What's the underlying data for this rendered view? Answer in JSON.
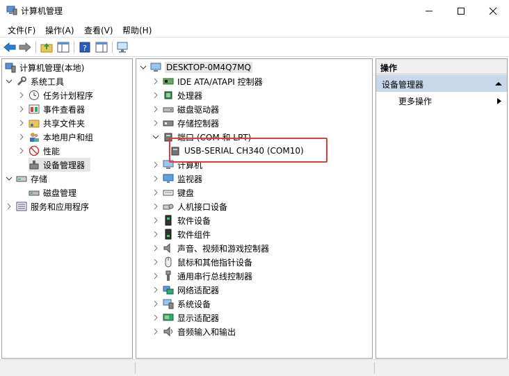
{
  "window": {
    "title": "计算机管理"
  },
  "menu": {
    "file": "文件(F)",
    "action": "操作(A)",
    "view": "查看(V)",
    "help": "帮助(H)"
  },
  "left_tree": {
    "root": "计算机管理(本地)",
    "system_tools": "系统工具",
    "task_scheduler": "任务计划程序",
    "event_viewer": "事件查看器",
    "shared_folders": "共享文件夹",
    "local_users": "本地用户和组",
    "performance": "性能",
    "device_manager": "设备管理器",
    "storage": "存储",
    "disk_management": "磁盘管理",
    "services": "服务和应用程序"
  },
  "device_tree": {
    "root": "DESKTOP-0M4Q7MQ",
    "categories": [
      {
        "label": "IDE ATA/ATAPI 控制器",
        "icon": "ide-controller-icon"
      },
      {
        "label": "处理器",
        "icon": "processor-icon"
      },
      {
        "label": "磁盘驱动器",
        "icon": "disk-drive-icon"
      },
      {
        "label": "存储控制器",
        "icon": "storage-controller-icon"
      },
      {
        "label": "端口 (COM 和 LPT)",
        "icon": "port-icon",
        "expanded": true
      },
      {
        "label": "USB-SERIAL CH340 (COM10)",
        "icon": "port-device-icon",
        "child": true
      },
      {
        "label": "计算机",
        "icon": "computer-icon"
      },
      {
        "label": "监视器",
        "icon": "monitor-icon"
      },
      {
        "label": "键盘",
        "icon": "keyboard-icon"
      },
      {
        "label": "人机接口设备",
        "icon": "hid-icon"
      },
      {
        "label": "软件设备",
        "icon": "software-device-icon"
      },
      {
        "label": "软件组件",
        "icon": "software-component-icon"
      },
      {
        "label": "声音、视频和游戏控制器",
        "icon": "sound-icon"
      },
      {
        "label": "鼠标和其他指针设备",
        "icon": "mouse-icon"
      },
      {
        "label": "通用串行总线控制器",
        "icon": "usb-icon"
      },
      {
        "label": "网络适配器",
        "icon": "network-adapter-icon"
      },
      {
        "label": "系统设备",
        "icon": "system-device-icon"
      },
      {
        "label": "显示适配器",
        "icon": "display-adapter-icon"
      },
      {
        "label": "音频输入和输出",
        "icon": "audio-io-icon"
      }
    ]
  },
  "actions": {
    "header": "操作",
    "section": "设备管理器",
    "more": "更多操作"
  },
  "colors": {
    "highlight_box": "#e03b3b",
    "selection": "#e5e5e5",
    "action_section": "#c8d7ea"
  }
}
